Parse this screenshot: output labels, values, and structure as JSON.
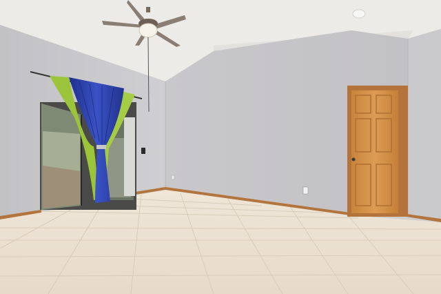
{
  "scene": {
    "subject": "empty-room-interior",
    "colors": {
      "ceiling": "#ececea",
      "wall_left": "#c8c7c9",
      "wall_back": "#c4c3c6",
      "wall_right": "#cac9cb",
      "floor_tile": "#eadfcf",
      "grout": "#d9cdbc",
      "baseboard": "#b3753e",
      "door_wood": "#d6934a",
      "curtain_blue": "#2a3fa8",
      "curtain_green": "#9cc63c",
      "fan_blade": "#8a7d73"
    }
  }
}
